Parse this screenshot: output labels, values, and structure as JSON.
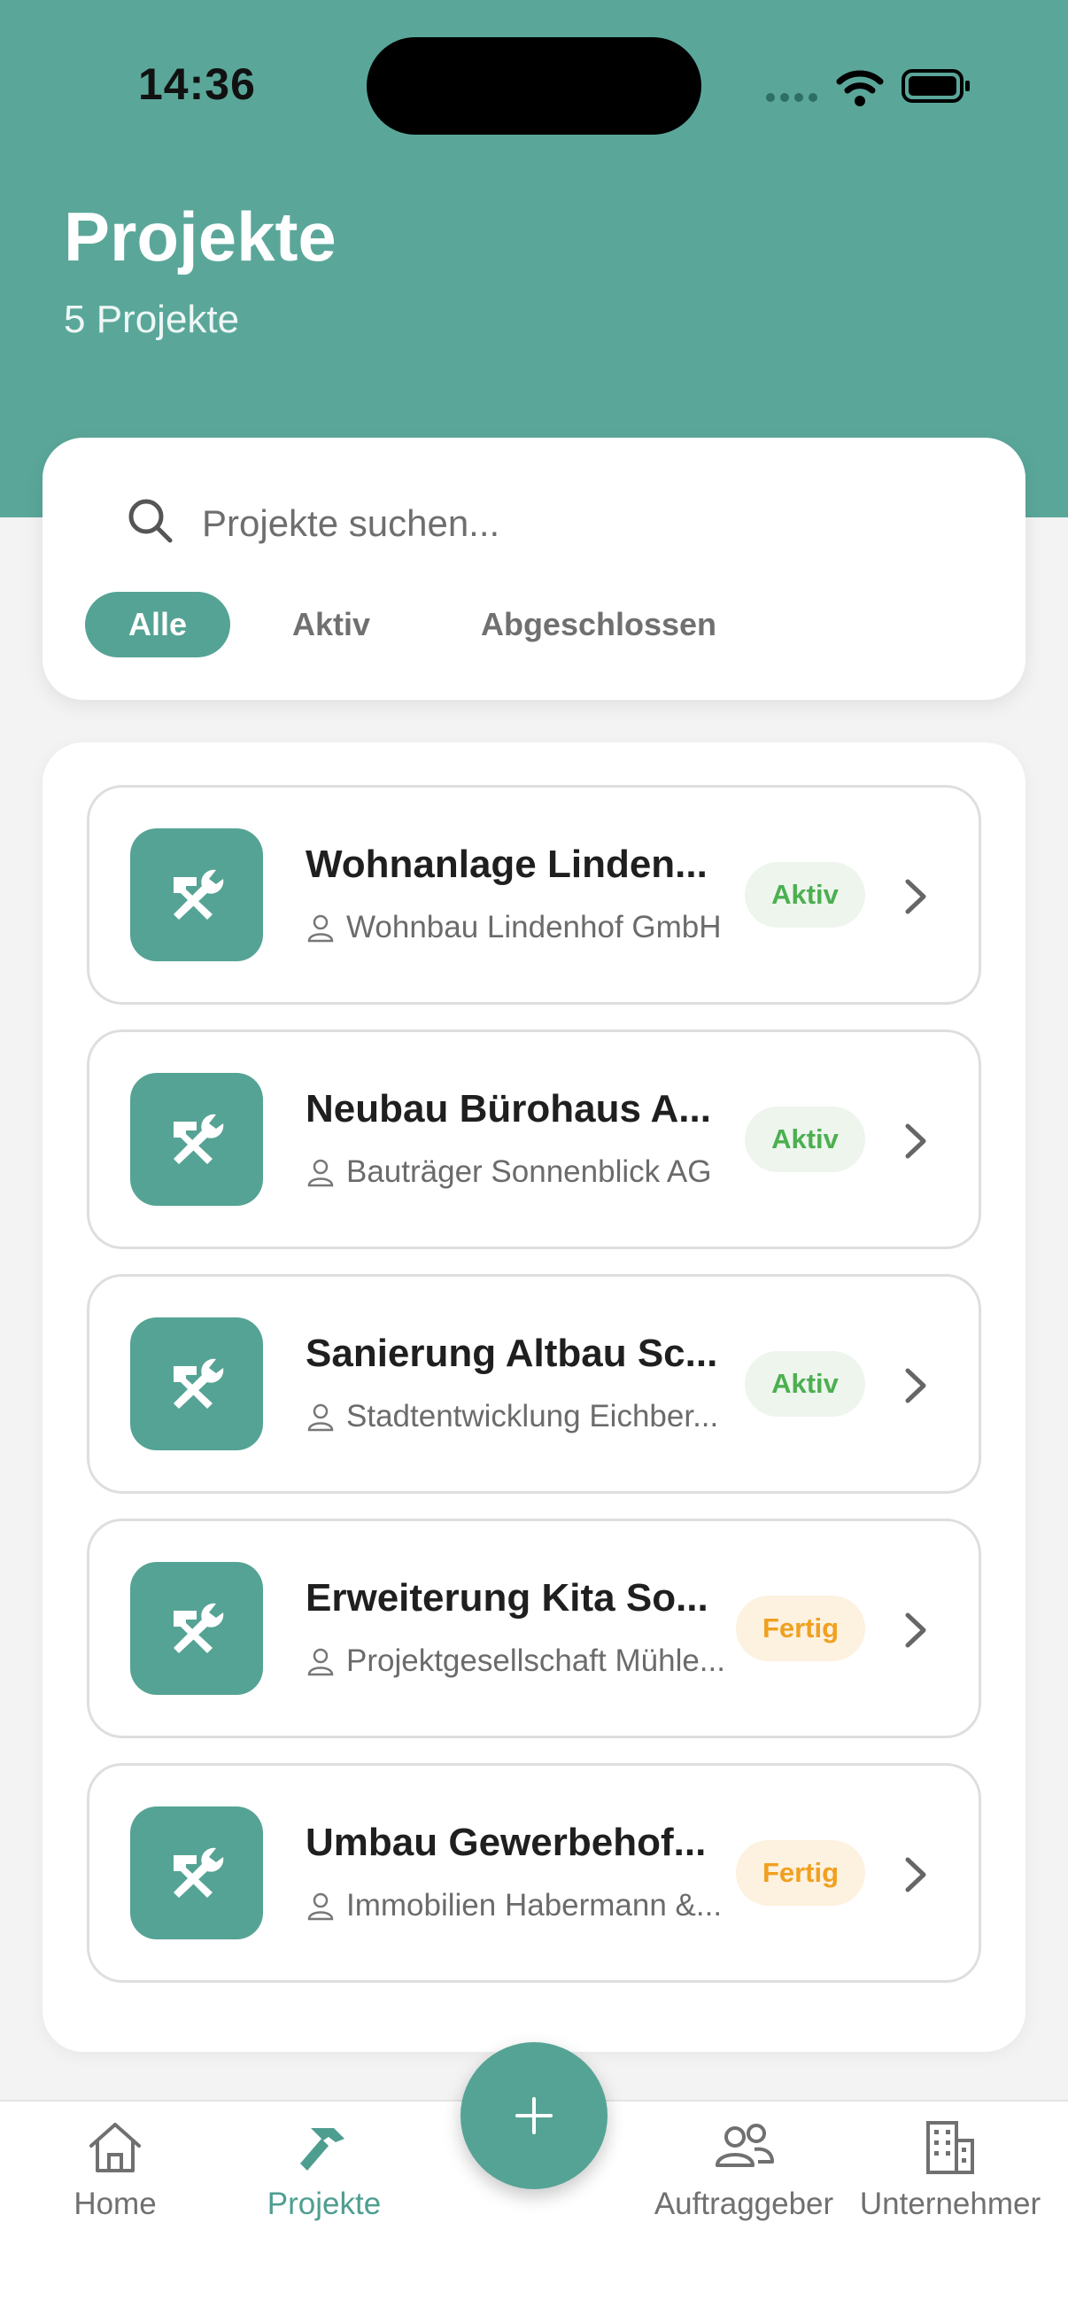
{
  "status_bar": {
    "time": "14:36"
  },
  "header": {
    "title": "Projekte",
    "subtitle": "5 Projekte"
  },
  "search": {
    "placeholder": "Projekte suchen..."
  },
  "filters": [
    {
      "label": "Alle",
      "active": true
    },
    {
      "label": "Aktiv",
      "active": false
    },
    {
      "label": "Abgeschlossen",
      "active": false
    }
  ],
  "projects": [
    {
      "title": "Wohnanlage Linden...",
      "client": "Wohnbau Lindenhof GmbH",
      "status": "Aktiv",
      "icon": "tools-icon"
    },
    {
      "title": "Neubau Bürohaus A...",
      "client": "Bauträger Sonnenblick AG",
      "status": "Aktiv",
      "icon": "tools-icon"
    },
    {
      "title": "Sanierung Altbau Sc...",
      "client": "Stadtentwicklung Eichber...",
      "status": "Aktiv",
      "icon": "tools-icon"
    },
    {
      "title": "Erweiterung Kita So...",
      "client": "Projektgesellschaft Mühle...",
      "status": "Fertig",
      "icon": "tools-icon"
    },
    {
      "title": "Umbau Gewerbehof...",
      "client": "Immobilien Habermann &...",
      "status": "Fertig",
      "icon": "tools-icon"
    }
  ],
  "tabs": [
    {
      "label": "Home",
      "icon": "home-icon",
      "active": false
    },
    {
      "label": "Projekte",
      "icon": "hammer-icon",
      "active": true
    },
    {
      "label": "Auftraggeber",
      "icon": "people-icon",
      "active": false
    },
    {
      "label": "Unternehmer",
      "icon": "building-icon",
      "active": false
    }
  ],
  "fab": {
    "icon": "plus-icon"
  },
  "colors": {
    "primary": "#55a394",
    "header": "#5aa79a",
    "active_badge_text": "#4caf50",
    "active_badge_bg": "#edf5ed",
    "done_badge_text": "#f0a020",
    "done_badge_bg": "#fdf1df"
  }
}
